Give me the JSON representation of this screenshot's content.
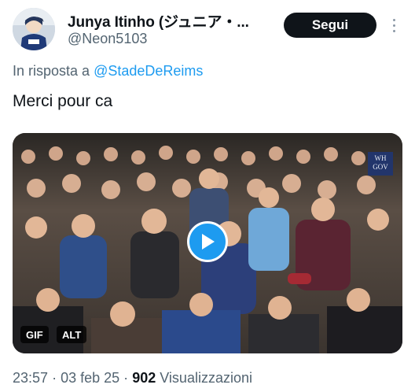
{
  "author": {
    "display_name": "Junya Itinho (ジュニア・...",
    "handle": "@Neon5103"
  },
  "follow_button": {
    "label": "Segui"
  },
  "reply": {
    "prefix": "In risposta a",
    "mention": "@StadeDeReims"
  },
  "tweet": {
    "text": "Merci pour ca"
  },
  "media": {
    "watermark": [
      "WH",
      "GOV"
    ],
    "badges": {
      "gif": "GIF",
      "alt": "ALT"
    }
  },
  "meta": {
    "time": "23:57",
    "date": "03 feb 25",
    "separator": "·",
    "views_count": "902",
    "views_label": "Visualizzazioni"
  },
  "colors": {
    "accent": "#1d9bf0",
    "button": "#0f1419",
    "secondary_text": "#536471"
  },
  "icons": [
    "avatar-image",
    "more-options-icon",
    "play-icon"
  ]
}
